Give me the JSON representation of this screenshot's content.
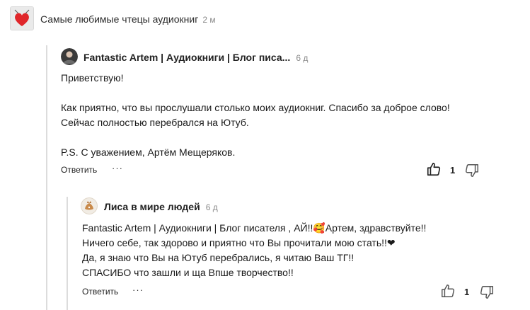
{
  "top": {
    "title": "Самые любимые чтецы аудиокниг",
    "time": "2 м",
    "avatar_icon": "heart-icon"
  },
  "comment1": {
    "author": "Fantastic Artem | Аудиокниги | Блог писа...",
    "time": "6 д",
    "lines": [
      "Приветствую!",
      "",
      "Как приятно, что вы прослушали столько моих аудиокниг. Спасибо за доброе слово!",
      "Сейчас полностью перебрался на Ютуб.",
      "",
      "P.S. С уважением, Артём Мещеряков."
    ],
    "reply_label": "Ответить",
    "more_label": "···",
    "likes": "1"
  },
  "comment2": {
    "author": "Лиса в мире людей",
    "time": "6 д",
    "lines": [
      "Fantastic Artem | Аудиокниги | Блог писателя , АЙ!!🥰Артем, здравствуйте!!",
      "Ничего себе, так здорово и приятно что Вы прочитали мою стать!!❤",
      "Да, я знаю что Вы на Ютуб перебрались, я читаю Ваш ТГ!!",
      "СПАСИБО что зашли и ща Впше творчество!!"
    ],
    "reply_label": "Ответить",
    "more_label": "···",
    "likes": "1"
  },
  "colors": {
    "heart": "#e0262a",
    "thread": "#dcdcdc",
    "meta": "#8a8a8a"
  }
}
